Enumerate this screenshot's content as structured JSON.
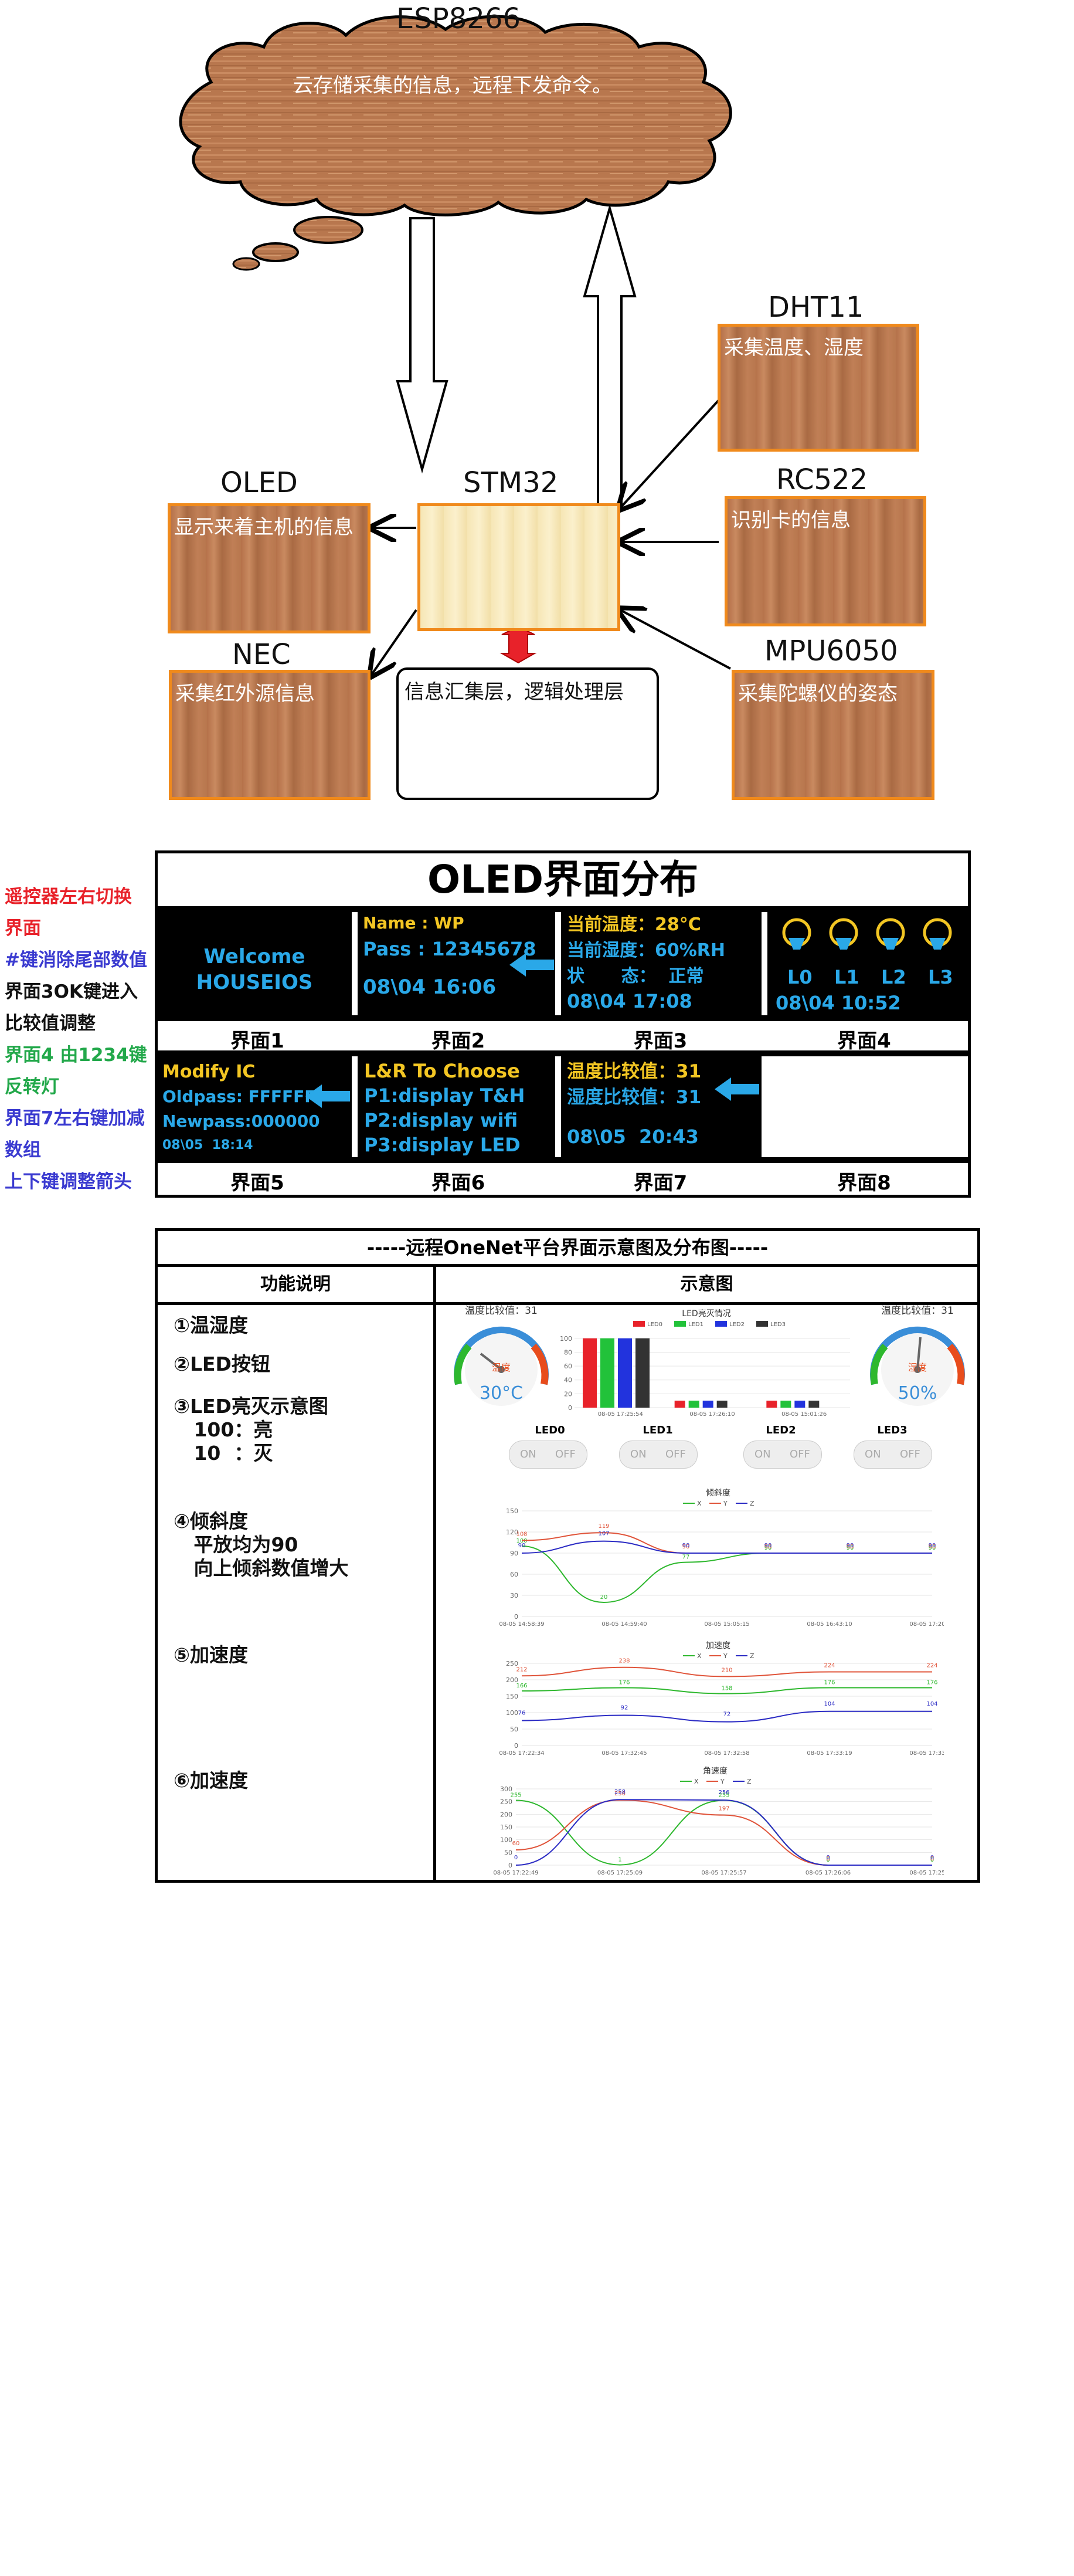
{
  "top": {
    "esp_label": "ESP8266",
    "cloud_text": "云存储采集的信息，远程下发命令。",
    "stm_label": "STM32",
    "info_text": "信息汇集层，逻辑处理层",
    "modules": [
      {
        "name": "DHT11",
        "text": "采集温度、湿度"
      },
      {
        "name": "RC522",
        "text": "识别卡的信息"
      },
      {
        "name": "MPU6050",
        "text": "采集陀螺仪的姿态"
      },
      {
        "name": "OLED",
        "text": "显示来着主机的信息"
      },
      {
        "name": "NEC",
        "text": "采集红外源信息"
      }
    ]
  },
  "oled": {
    "title": "OLED界面分布",
    "side_notes": [
      {
        "text": "遥控器左右切换",
        "color": "#e8222a"
      },
      {
        "text": "界面",
        "color": "#e8222a"
      },
      {
        "text": "#键消除尾部数值",
        "color": "#3a3ad0"
      },
      {
        "text": "界面3OK键进入",
        "color": "#111111"
      },
      {
        "text": "比较值调整",
        "color": "#111111"
      },
      {
        "text": "界面4 由1234键",
        "color": "#22a84a"
      },
      {
        "text": "反转灯",
        "color": "#22a84a"
      },
      {
        "text": "界面7左右键加减",
        "color": "#3a3ad0"
      },
      {
        "text": "数组",
        "color": "#3a3ad0"
      },
      {
        "text": "上下键调整箭头",
        "color": "#3a3ad0"
      }
    ],
    "screens_row1": {
      "s1": {
        "l1": "Welcome",
        "l2": "HOUSEIOS"
      },
      "s2": {
        "l1": "Name : WP",
        "l2": "Pass : 12345678",
        "l3": "08\\04 16:06"
      },
      "s3": {
        "l1": "当前温度：28°C",
        "l2": "当前湿度：60%RH",
        "l3": "状      态：  正常",
        "l4": "08\\04 17:08"
      },
      "s4": {
        "lamps": [
          "L0",
          "L1",
          "L2",
          "L3"
        ],
        "date": "08\\04 10:52"
      }
    },
    "screens_row2": {
      "s5": {
        "l1": "Modify IC",
        "l2": "Oldpass: FFFFFF",
        "l3": "Newpass:000000",
        "l4": "08\\05  18:14"
      },
      "s6": {
        "l1": "L&R To Choose",
        "l2": "P1:display T&H",
        "l3": "P2:display wifi",
        "l4": "P3:display LED"
      },
      "s7": {
        "l1": "温度比较值：31",
        "l2": "湿度比较值：31",
        "l3": "08\\05  20:43"
      }
    },
    "captions_row1": [
      "界面1",
      "界面2",
      "界面3",
      "界面4"
    ],
    "captions_row2": [
      "界面5",
      "界面6",
      "界面7",
      "界面8"
    ]
  },
  "onenet": {
    "title": "-----远程OneNet平台界面示意图及分布图-----",
    "col1": "功能说明",
    "col2": "示意图",
    "functions": [
      "①温湿度",
      "②LED按钮",
      "③LED亮灭示意图\n   100：亮\n   10  ：灭",
      "④倾斜度\n   平放均为90\n   向上倾斜数值增大",
      "⑤加速度",
      "⑥加速度"
    ],
    "gauge_left": {
      "title": "温度比较值：31",
      "value": "30°C",
      "center": "温度"
    },
    "gauge_right": {
      "title": "温度比较值：31",
      "value": "50%",
      "center": "湿度"
    },
    "led_switches": [
      {
        "name": "LED0",
        "on": "ON",
        "off": "OFF"
      },
      {
        "name": "LED1",
        "on": "ON",
        "off": "OFF"
      },
      {
        "name": "LED2",
        "on": "ON",
        "off": "OFF"
      },
      {
        "name": "LED3",
        "on": "ON",
        "off": "OFF"
      }
    ],
    "colors": {
      "x": "#2eb82e",
      "y": "#e0543a",
      "z": "#2b2bc4",
      "led0": "#e8222a",
      "led1": "#22c23a",
      "led2": "#2233dd",
      "led3": "#333333"
    }
  },
  "chart_data": [
    {
      "type": "bar",
      "title": "LED亮灭情况",
      "legend": [
        "LED0",
        "LED1",
        "LED2",
        "LED3"
      ],
      "categories": [
        "08-05 17:25:54",
        "08-05 17:26:10",
        "08-05 15:01:26"
      ],
      "series": [
        {
          "name": "LED0",
          "values": [
            100,
            10,
            10
          ]
        },
        {
          "name": "LED1",
          "values": [
            100,
            10,
            10
          ]
        },
        {
          "name": "LED2",
          "values": [
            100,
            10,
            10
          ]
        },
        {
          "name": "LED3",
          "values": [
            100,
            10,
            10
          ]
        }
      ],
      "yticks": [
        0,
        20,
        40,
        60,
        80,
        100
      ],
      "ylim": [
        0,
        110
      ]
    },
    {
      "type": "line",
      "title": "倾斜度",
      "legend": [
        "X",
        "Y",
        "Z"
      ],
      "x": [
        "08-05 14:58:39",
        "08-05 14:59:40",
        "08-05 15:05:15",
        "08-05 16:43:10",
        "08-05 17:20:32"
      ],
      "series": [
        {
          "name": "X",
          "values": [
            100,
            20,
            77,
            90,
            90,
            90
          ]
        },
        {
          "name": "Y",
          "values": [
            108,
            119,
            90,
            90,
            90,
            90
          ]
        },
        {
          "name": "Z",
          "values": [
            90,
            107,
            90,
            90,
            90,
            90
          ]
        }
      ],
      "labels": [
        "108",
        "119",
        "107",
        "90",
        "90",
        "90",
        "90",
        "77"
      ],
      "yticks": [
        0,
        30,
        60,
        90,
        120,
        150
      ],
      "ylim": [
        0,
        150
      ]
    },
    {
      "type": "line",
      "title": "加速度",
      "legend": [
        "X",
        "Y",
        "Z"
      ],
      "x": [
        "08-05 17:22:34",
        "08-05 17:32:45",
        "08-05 17:32:58",
        "08-05 17:33:19",
        "08-05 17:33:08"
      ],
      "series": [
        {
          "name": "X",
          "values": [
            166,
            176,
            158,
            176,
            176
          ]
        },
        {
          "name": "Y",
          "values": [
            212,
            238,
            210,
            224,
            224
          ]
        },
        {
          "name": "Z",
          "values": [
            76,
            92,
            72,
            104,
            104
          ]
        }
      ],
      "yticks": [
        0,
        50,
        100,
        150,
        200,
        250
      ],
      "ylim": [
        0,
        250
      ]
    },
    {
      "type": "line",
      "title": "角速度",
      "legend": [
        "X",
        "Y",
        "Z"
      ],
      "x": [
        "08-05 17:22:49",
        "08-05 17:25:09",
        "08-05 17:25:57",
        "08-05 17:26:06",
        "08-05 17:25:35"
      ],
      "series": [
        {
          "name": "X",
          "values": [
            255,
            1,
            255,
            0,
            0
          ]
        },
        {
          "name": "Y",
          "values": [
            60,
            256,
            197,
            0,
            0
          ]
        },
        {
          "name": "Z",
          "values": [
            0,
            258,
            256,
            0,
            0
          ]
        }
      ],
      "yticks": [
        0,
        50,
        100,
        150,
        200,
        250,
        300
      ],
      "ylim": [
        0,
        300
      ]
    }
  ]
}
